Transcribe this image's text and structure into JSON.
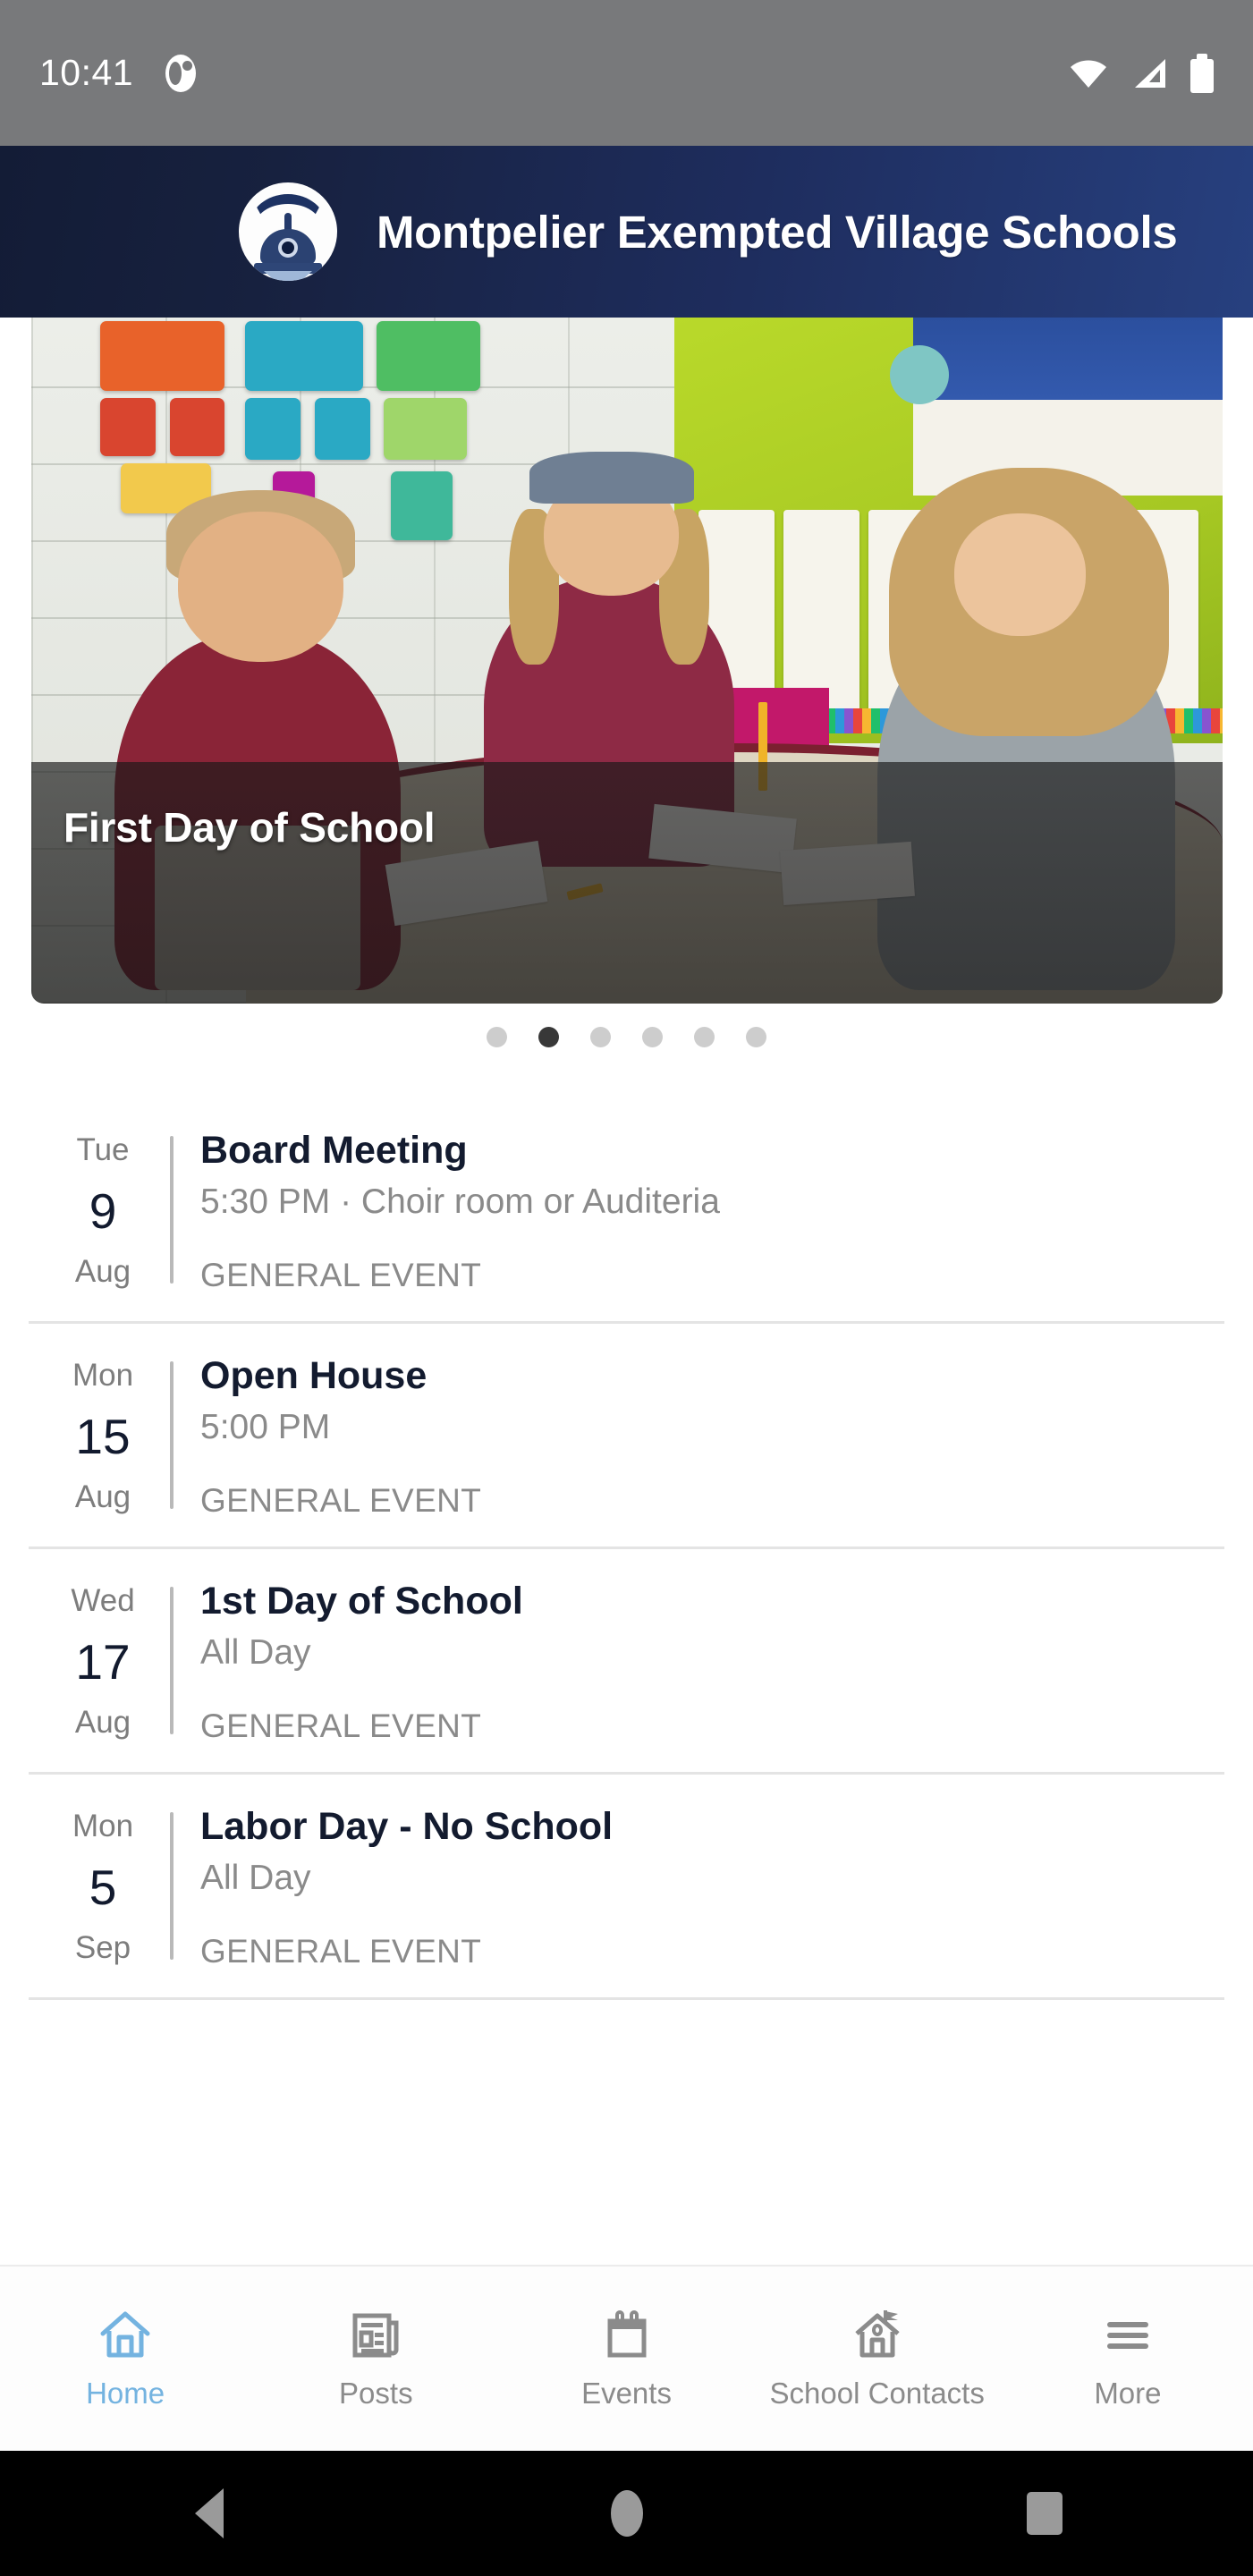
{
  "statusbar": {
    "time": "10:41",
    "app_notification_icon": "app-notification-icon",
    "wifi_icon": "wifi-icon",
    "signal_icon": "cell-signal-icon",
    "battery_icon": "battery-full-icon"
  },
  "header": {
    "title": "Montpelier Exempted Village Schools",
    "logo_alt": "Montpelier Locomotives school logo",
    "gradient_start": "#131c36",
    "gradient_end": "#27407f"
  },
  "hero": {
    "caption": "First Day of School",
    "photo_description": "Three students seated at a round classroom table with papers and pencils, colorful alphabet letters and anchor charts on the wall behind them",
    "dots_total": 6,
    "dots_active_index": 1
  },
  "events": [
    {
      "dow": "Tue",
      "day": "9",
      "month": "Aug",
      "title": "Board Meeting",
      "subtitle": "5:30 PM · Choir room or Auditeria",
      "category": "GENERAL EVENT"
    },
    {
      "dow": "Mon",
      "day": "15",
      "month": "Aug",
      "title": "Open House",
      "subtitle": "5:00 PM",
      "category": "GENERAL EVENT"
    },
    {
      "dow": "Wed",
      "day": "17",
      "month": "Aug",
      "title": "1st Day of School",
      "subtitle": "All Day",
      "category": "GENERAL EVENT"
    },
    {
      "dow": "Mon",
      "day": "5",
      "month": "Sep",
      "title": "Labor Day - No School",
      "subtitle": "All Day",
      "category": "GENERAL EVENT"
    }
  ],
  "tabbar": {
    "active_color": "#74b3e0",
    "inactive_color": "#8b8b8b",
    "items": [
      {
        "label": "Home",
        "icon": "home-icon",
        "active": true
      },
      {
        "label": "Posts",
        "icon": "newspaper-icon",
        "active": false
      },
      {
        "label": "Events",
        "icon": "calendar-icon",
        "active": false
      },
      {
        "label": "School Contacts",
        "icon": "school-building-icon",
        "active": false
      },
      {
        "label": "More",
        "icon": "hamburger-menu-icon",
        "active": false
      }
    ]
  },
  "navbar": {
    "back": "back-button",
    "home": "home-button",
    "recents": "recents-button"
  }
}
